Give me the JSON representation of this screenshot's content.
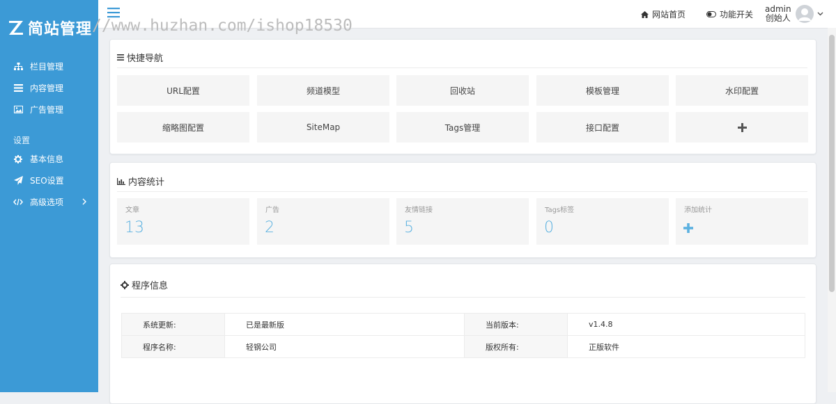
{
  "brand": {
    "logo_text": "简站管理",
    "watermark": "//www.huzhan.com/ishop18530"
  },
  "sidebar": {
    "items": [
      {
        "label": "栏目管理",
        "icon": "sitemap-icon"
      },
      {
        "label": "内容管理",
        "icon": "list-icon"
      },
      {
        "label": "广告管理",
        "icon": "image-icon"
      }
    ],
    "section_label": "设置",
    "settings_items": [
      {
        "label": "基本信息",
        "icon": "gear-icon"
      },
      {
        "label": "SEO设置",
        "icon": "paper-plane-icon"
      },
      {
        "label": "高级选项",
        "icon": "code-icon"
      }
    ]
  },
  "topbar": {
    "home_link": "网站首页",
    "feature_toggle": "功能开关",
    "user_name": "admin",
    "user_role": "创始人"
  },
  "quick_nav": {
    "title": "快捷导航",
    "tiles": [
      "URL配置",
      "频道模型",
      "回收站",
      "模板管理",
      "水印配置",
      "缩略图配置",
      "SiteMap",
      "Tags管理",
      "接口配置"
    ],
    "add_icon": "plus-icon"
  },
  "stats": {
    "title": "内容统计",
    "items": [
      {
        "label": "文章",
        "value": "13"
      },
      {
        "label": "广告",
        "value": "2"
      },
      {
        "label": "友情链接",
        "value": "5"
      },
      {
        "label": "Tags标签",
        "value": "0"
      }
    ],
    "add_label": "添加统计"
  },
  "program_info": {
    "title": "程序信息",
    "rows": [
      {
        "k1": "系统更新:",
        "v1": "已是最新版",
        "k2": "当前版本:",
        "v2": "v1.4.8"
      },
      {
        "k1": "程序名称:",
        "v1": "轻钢公司",
        "k2": "版权所有:",
        "v2": "正版软件"
      }
    ]
  },
  "colors": {
    "sidebar": "#3c9ad6",
    "accent": "#5bb1e0"
  }
}
